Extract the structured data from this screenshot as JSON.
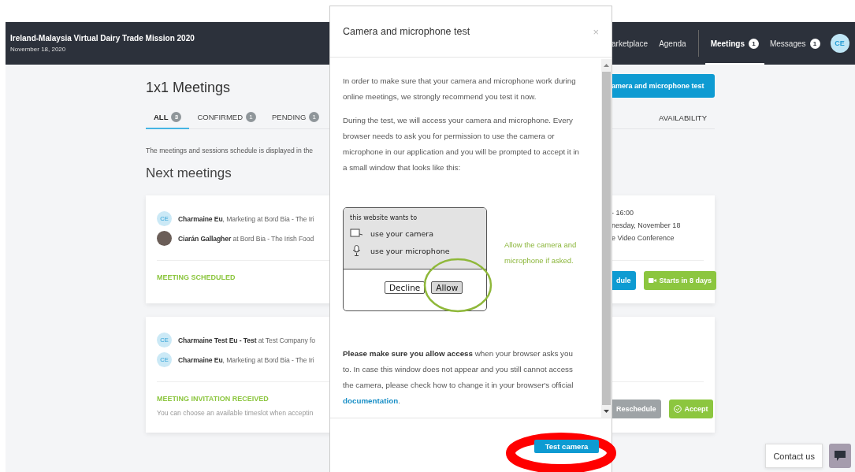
{
  "header": {
    "title": "Ireland-Malaysia Virtual Dairy Trade Mission 2020",
    "date": "November 18, 2020",
    "nav_primary": [
      {
        "label": "arketplace",
        "selected": false
      },
      {
        "label": "Agenda",
        "selected": false
      }
    ],
    "nav_secondary": [
      {
        "label": "Meetings",
        "badge": "1",
        "selected": true
      },
      {
        "label": "Messages",
        "badge": "1",
        "selected": false
      }
    ],
    "avatar": "CE"
  },
  "page": {
    "title": "1x1 Meetings",
    "test_button": "amera and microphone test",
    "tabs": [
      {
        "label": "ALL",
        "count": "3",
        "selected": true
      },
      {
        "label": "CONFIRMED",
        "count": "1",
        "selected": false
      },
      {
        "label": "PENDING",
        "count": "1",
        "selected": false
      }
    ],
    "availability": "AVAILABILITY",
    "description": "The meetings and sessions schedule is displayed in the",
    "section_title": "Next meetings"
  },
  "meetings": [
    {
      "participants": [
        {
          "kind": "initials",
          "initials": "CE",
          "text": "**Charmaine Eu**, Marketing at Bord Bia - The Iri"
        },
        {
          "kind": "photo",
          "text": "**Ciarán Gallagher** at Bord Bia - The Irish Food"
        }
      ],
      "details": [
        "- 16:00",
        "nesday, November 18",
        "e Video Conference"
      ],
      "status": "MEETING SCHEDULED",
      "actions": [
        {
          "label": "dule",
          "kind": "primary"
        },
        {
          "label": "Starts in 8 days",
          "kind": "join"
        }
      ]
    },
    {
      "participants": [
        {
          "kind": "initials",
          "initials": "CE",
          "text": "**Charmaine Test Eu - Test** at Test Company fo"
        },
        {
          "kind": "initials",
          "initials": "CE",
          "text": "**Charmaine Eu**, Marketing at Bord Bia - The Iri"
        }
      ],
      "status": "MEETING INVITATION RECEIVED",
      "note": "You can choose an available timeslot when acceptin",
      "actions": [
        {
          "label": "Reschedule",
          "kind": "muted"
        },
        {
          "label": "Accept",
          "kind": "accept"
        }
      ]
    }
  ],
  "modal": {
    "title": "Camera and microphone test",
    "close": "×",
    "paragraphs": [
      "In order to make sure that your camera and microphone work during online meetings, we strongly recommend you test it now.",
      "During the test, we will access your camera and microphone. Every browser needs to ask you for permission to use the camera or microphone in our application and you will be prompted to accept it in a small window that looks like this:"
    ],
    "illustration": {
      "prompt": "this website wants to",
      "items": [
        {
          "kind": "camera",
          "label": "use your camera"
        },
        {
          "kind": "microphone",
          "label": "use your microphone"
        }
      ],
      "buttons": [
        {
          "label": "Decline",
          "highlighted": false
        },
        {
          "label": "Allow",
          "highlighted": true
        }
      ]
    },
    "hint": "Allow the camera and microphone if asked.",
    "note": "**Please make sure you allow access** when your browser asks you to. In case this window does not appear and you still cannot access the camera, please check how to change it in your browser's official ",
    "link": "documentation",
    "note_end": ".",
    "button": "Test camera"
  },
  "contact_button": "Contact us"
}
